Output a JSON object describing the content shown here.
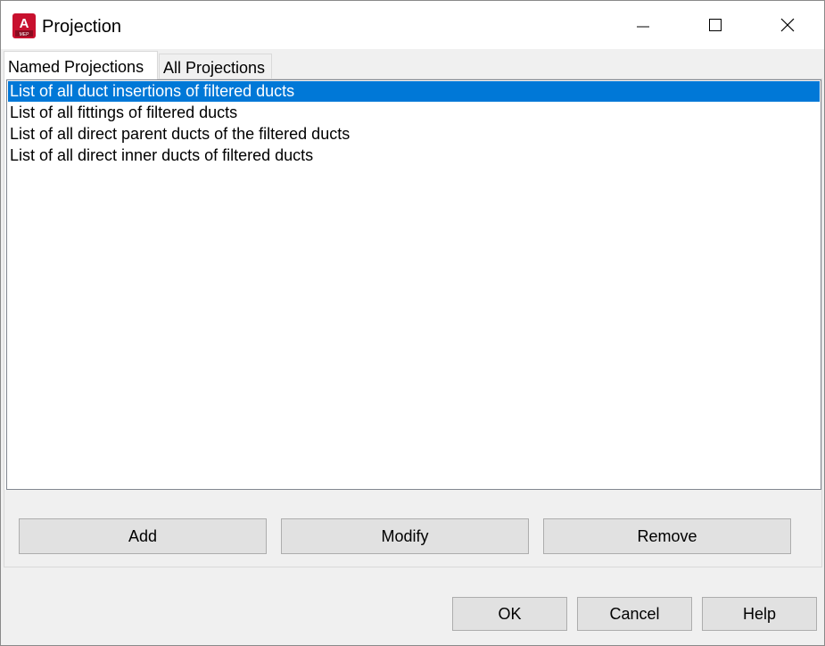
{
  "window": {
    "title": "Projection",
    "app_icon": {
      "glyph": "A",
      "sublabel": "MEP",
      "color": "#c8102e"
    },
    "controls": {
      "minimize": "minimize-icon",
      "maximize": "maximize-icon",
      "close": "close-icon"
    }
  },
  "tabs": [
    {
      "label": "Named Projections",
      "active": true
    },
    {
      "label": "All Projections",
      "active": false
    }
  ],
  "list": {
    "items": [
      "List of all duct insertions of filtered ducts",
      "List of all fittings of filtered ducts",
      "List of all direct parent ducts of the filtered ducts",
      "List of all direct inner ducts of filtered ducts"
    ],
    "selected_index": 0,
    "selection_color": "#0078d7"
  },
  "panel_buttons": {
    "add": "Add",
    "modify": "Modify",
    "remove": "Remove"
  },
  "dialog_buttons": {
    "ok": "OK",
    "cancel": "Cancel",
    "help": "Help"
  }
}
